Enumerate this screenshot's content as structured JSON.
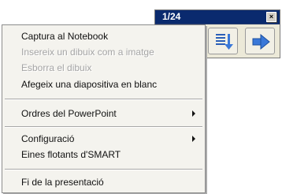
{
  "toolbar": {
    "slide_counter": "1/24",
    "close_label": "×",
    "buttons": [
      {
        "icon": "slide-list-icon"
      },
      {
        "icon": "next-arrow-icon"
      }
    ]
  },
  "menu": {
    "items": [
      {
        "label": "Captura al Notebook",
        "enabled": true,
        "submenu": false
      },
      {
        "label": "Insereix un dibuix com a imatge",
        "enabled": false,
        "submenu": false
      },
      {
        "label": "Esborra el dibuix",
        "enabled": false,
        "submenu": false
      },
      {
        "label": "Afegeix una diapositiva en blanc",
        "enabled": true,
        "submenu": false
      },
      {
        "label": "Ordres del PowerPoint",
        "enabled": true,
        "submenu": true
      },
      {
        "label": "Configuració",
        "enabled": true,
        "submenu": true
      },
      {
        "label": "Eines flotants d'SMART",
        "enabled": true,
        "submenu": false
      },
      {
        "label": "Fi de la presentació",
        "enabled": true,
        "submenu": false
      }
    ]
  },
  "colors": {
    "titlebar": "#0a2a6e",
    "menu_bg": "#f4f3ee",
    "disabled_text": "#a5a5a5",
    "icon_blue": "#3a78d8"
  }
}
